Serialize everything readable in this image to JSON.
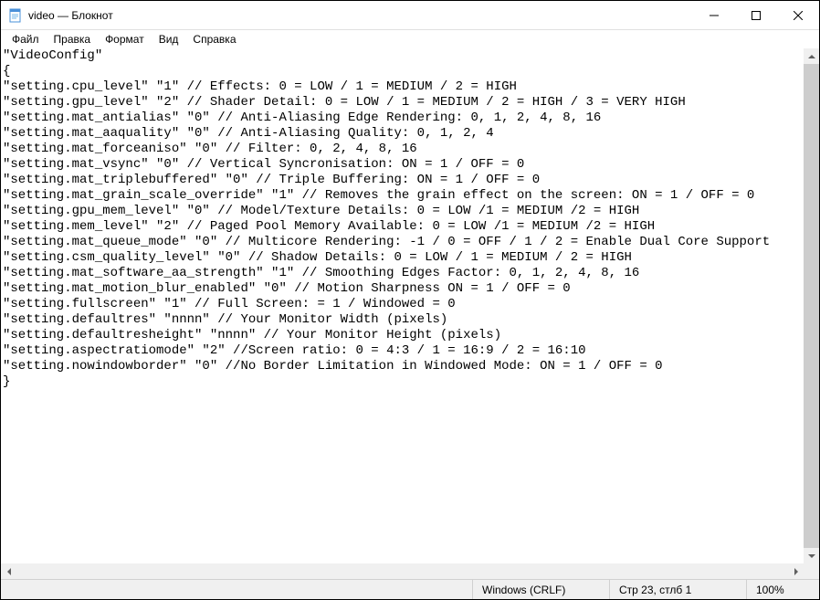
{
  "title": "video — Блокнот",
  "menu": {
    "file": "Файл",
    "edit": "Правка",
    "format": "Формат",
    "view": "Вид",
    "help": "Справка"
  },
  "content_lines": [
    "\"VideoConfig\"",
    "{",
    "\"setting.cpu_level\" \"1\" // Effects: 0 = LOW / 1 = MEDIUM / 2 = HIGH",
    "\"setting.gpu_level\" \"2\" // Shader Detail: 0 = LOW / 1 = MEDIUM / 2 = HIGH / 3 = VERY HIGH",
    "\"setting.mat_antialias\" \"0\" // Anti-Aliasing Edge Rendering: 0, 1, 2, 4, 8, 16",
    "\"setting.mat_aaquality\" \"0\" // Anti-Aliasing Quality: 0, 1, 2, 4",
    "\"setting.mat_forceaniso\" \"0\" // Filter: 0, 2, 4, 8, 16",
    "\"setting.mat_vsync\" \"0\" // Vertical Syncronisation: ON = 1 / OFF = 0",
    "\"setting.mat_triplebuffered\" \"0\" // Triple Buffering: ON = 1 / OFF = 0",
    "\"setting.mat_grain_scale_override\" \"1\" // Removes the grain effect on the screen: ON = 1 / OFF = 0",
    "\"setting.gpu_mem_level\" \"0\" // Model/Texture Details: 0 = LOW /1 = MEDIUM /2 = HIGH",
    "\"setting.mem_level\" \"2\" // Paged Pool Memory Available: 0 = LOW /1 = MEDIUM /2 = HIGH",
    "\"setting.mat_queue_mode\" \"0\" // Multicore Rendering: -1 / 0 = OFF / 1 / 2 = Enable Dual Core Support",
    "\"setting.csm_quality_level\" \"0\" // Shadow Details: 0 = LOW / 1 = MEDIUM / 2 = HIGH",
    "\"setting.mat_software_aa_strength\" \"1\" // Smoothing Edges Factor: 0, 1, 2, 4, 8, 16",
    "\"setting.mat_motion_blur_enabled\" \"0\" // Motion Sharpness ON = 1 / OFF = 0",
    "\"setting.fullscreen\" \"1\" // Full Screen: = 1 / Windowed = 0",
    "\"setting.defaultres\" \"nnnn\" // Your Monitor Width (pixels)",
    "\"setting.defaultresheight\" \"nnnn\" // Your Monitor Height (pixels)",
    "\"setting.aspectratiomode\" \"2\" //Screen ratio: 0 = 4:3 / 1 = 16:9 / 2 = 16:10",
    "\"setting.nowindowborder\" \"0\" //No Border Limitation in Windowed Mode: ON = 1 / OFF = 0",
    "}"
  ],
  "status": {
    "encoding": "Windows (CRLF)",
    "position": "Стр 23, стлб 1",
    "zoom": "100%"
  }
}
